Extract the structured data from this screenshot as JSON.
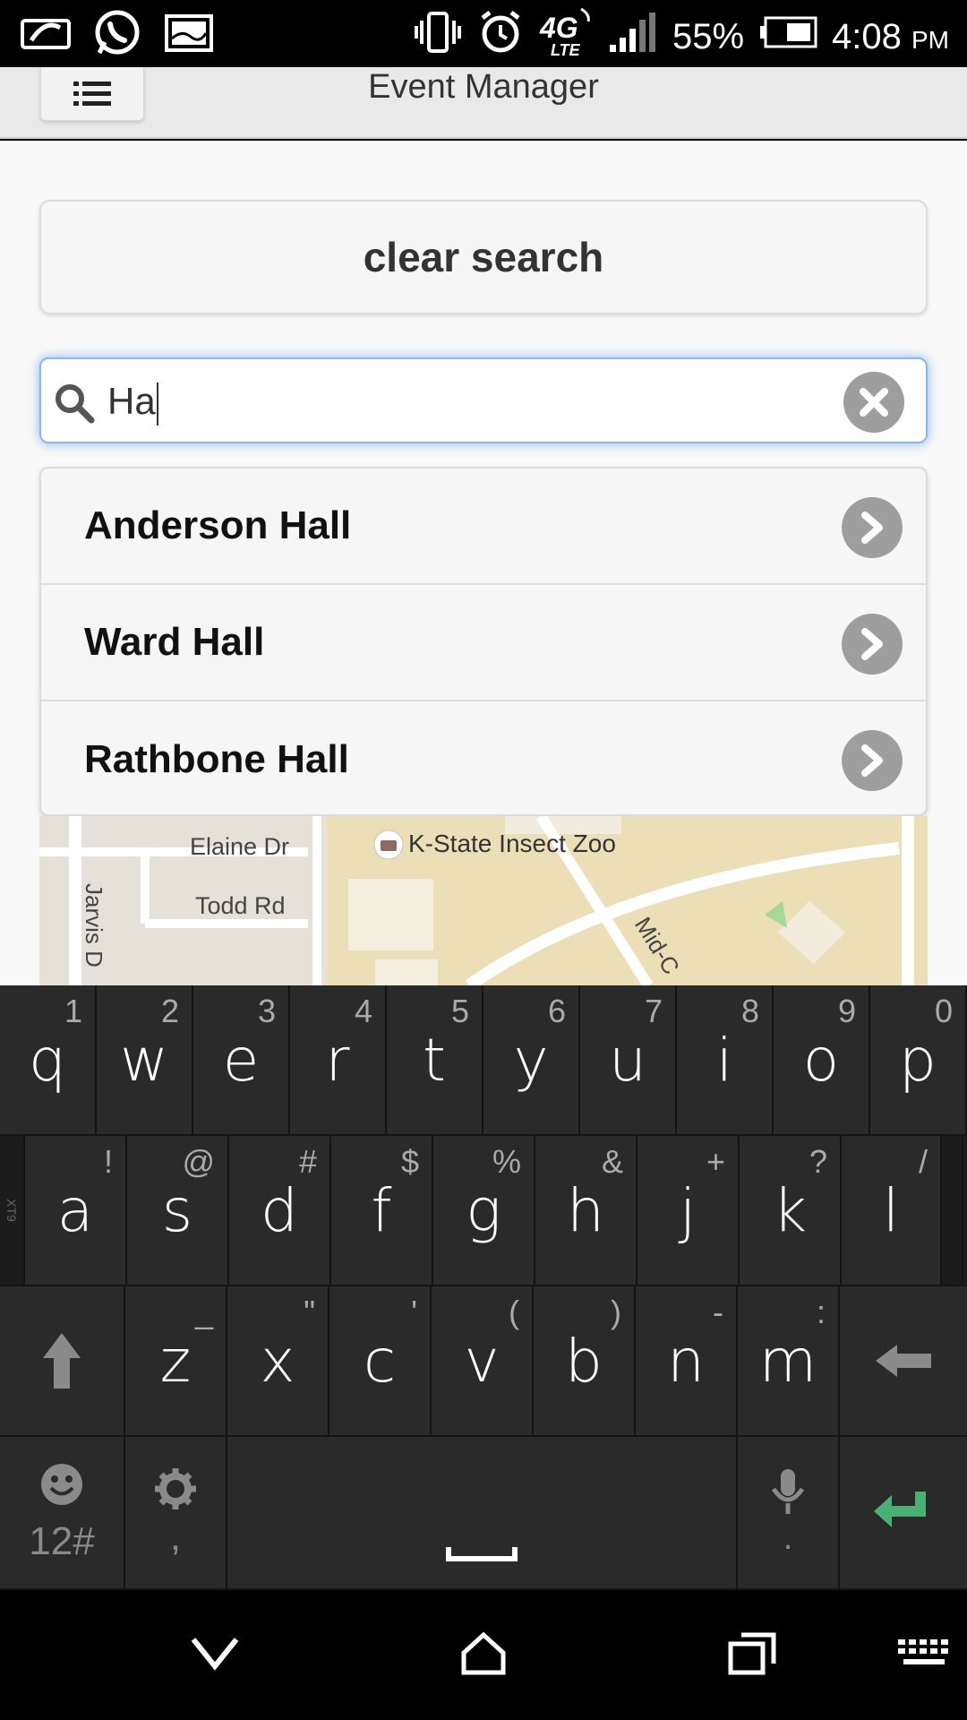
{
  "status_bar": {
    "battery_percent": "55%",
    "time": "4:08",
    "ampm": "PM",
    "network": "4G LTE",
    "icons": [
      "glasses-icon",
      "whatsapp-icon",
      "gallery-icon",
      "vibrate-icon",
      "alarm-icon",
      "4g-lte-icon",
      "signal-icon",
      "battery-icon"
    ]
  },
  "header": {
    "title": "Event Manager",
    "menu_icon": "list-menu-icon"
  },
  "clear_button": {
    "label": "clear search"
  },
  "search": {
    "value": "Ha"
  },
  "results": [
    {
      "label": "Anderson Hall"
    },
    {
      "label": "Ward Hall"
    },
    {
      "label": "Rathbone Hall"
    }
  ],
  "map": {
    "labels": {
      "elaine": "Elaine Dr",
      "todd": "Todd Rd",
      "zoo": "K-State Insect Zoo",
      "jarvis": "Jarvis D",
      "mid": "Mid-C"
    }
  },
  "keyboard": {
    "row1": [
      {
        "k": "q",
        "s": "1"
      },
      {
        "k": "w",
        "s": "2"
      },
      {
        "k": "e",
        "s": "3"
      },
      {
        "k": "r",
        "s": "4"
      },
      {
        "k": "t",
        "s": "5"
      },
      {
        "k": "y",
        "s": "6"
      },
      {
        "k": "u",
        "s": "7"
      },
      {
        "k": "i",
        "s": "8"
      },
      {
        "k": "o",
        "s": "9"
      },
      {
        "k": "p",
        "s": "0"
      }
    ],
    "row2": [
      {
        "k": "a",
        "s": "!"
      },
      {
        "k": "s",
        "s": "@"
      },
      {
        "k": "d",
        "s": "#"
      },
      {
        "k": "f",
        "s": "$"
      },
      {
        "k": "g",
        "s": "%"
      },
      {
        "k": "h",
        "s": "&"
      },
      {
        "k": "j",
        "s": "+"
      },
      {
        "k": "k",
        "s": "?"
      },
      {
        "k": "l",
        "s": "/"
      }
    ],
    "row3": [
      {
        "k": "z",
        "s": "_"
      },
      {
        "k": "x",
        "s": "\""
      },
      {
        "k": "c",
        "s": "'"
      },
      {
        "k": "v",
        "s": "("
      },
      {
        "k": "b",
        "s": ")"
      },
      {
        "k": "n",
        "s": "-"
      },
      {
        "k": "m",
        "s": ":"
      }
    ],
    "row2_side_label": "XT9",
    "numbers_key": "12#",
    "comma_key": ",",
    "period_key": "."
  },
  "colors": {
    "enter": "#4caf73",
    "focus": "#3a8ddc"
  }
}
